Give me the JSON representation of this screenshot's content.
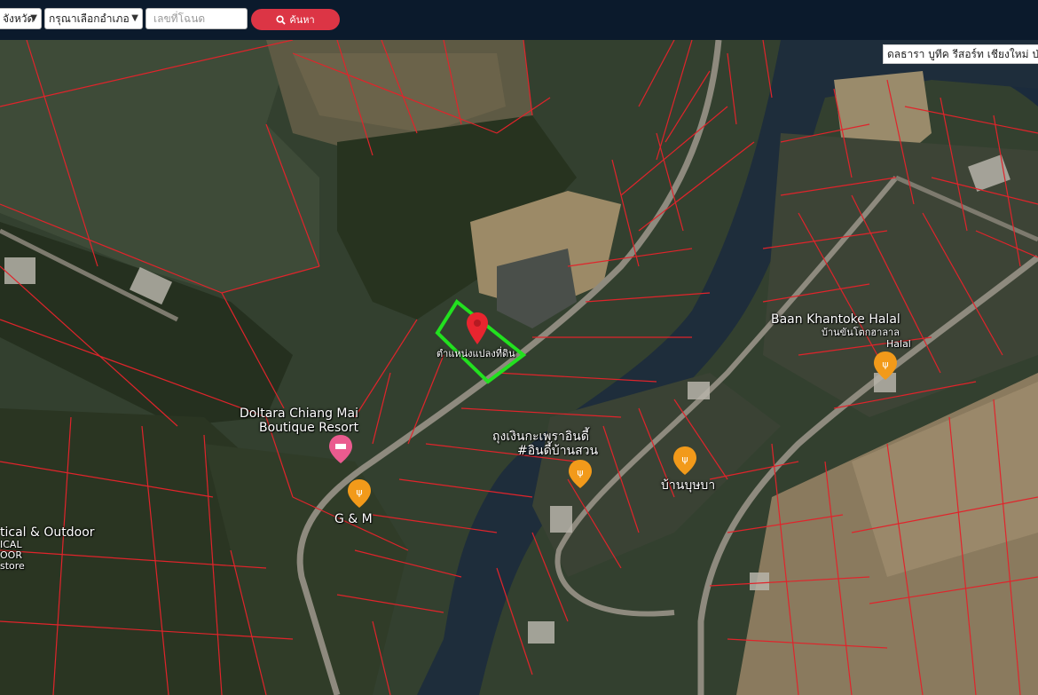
{
  "search": {
    "province_label": "จังหวัด",
    "district_label": "กรุณาเลือกอำเภอ",
    "deed_placeholder": "เลขที่โฉนด",
    "search_button": "ค้นหา"
  },
  "map": {
    "place_search_text": "ดลธารา บูทีค รีสอร์ท เชียงใหม่ ป่าแดด",
    "parcel_marker_label": "ตำแหน่งแปลงที่ดิน",
    "places": {
      "baan_khantoke": {
        "name_en": "Baan Khantoke Halal",
        "name_th": "บ้านขันโตกฮาลาล",
        "name_th2": "Halal"
      },
      "doltara": {
        "line1": "Doltara Chiang Mai",
        "line2": "Boutique Resort"
      },
      "tung_ngern": {
        "line1": "ถุงเงินกะเพราอินดี้",
        "line2": "#อินดี้บ้านสวน"
      },
      "baan_boonya": {
        "name": "บ้านบุษบา"
      },
      "g_and_m": {
        "name": "G & M"
      },
      "outdoor": {
        "line1": "tical & Outdoor",
        "line2": "ICAL",
        "line3": "OOR",
        "line4": "store"
      }
    },
    "colors": {
      "parcel_lines": "#e0242b",
      "highlight_parcel": "#22e11f",
      "marker": "#e8252f",
      "food_pin": "#f29a1a",
      "hotel_pin": "#ea5b8f"
    }
  }
}
